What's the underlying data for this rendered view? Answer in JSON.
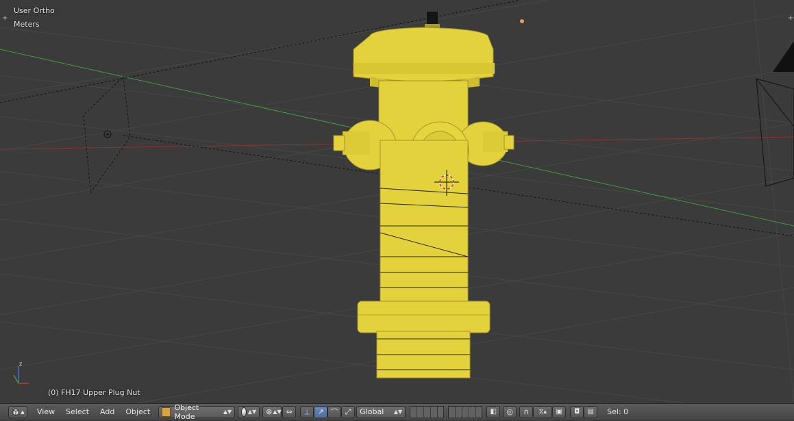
{
  "viewport": {
    "view_label": "User Ortho",
    "units_label": "Meters",
    "object_label": "(0) FH17 Upper Plug Nut"
  },
  "toolbar": {
    "menus": [
      "View",
      "Select",
      "Add",
      "Object"
    ],
    "mode": "Object Mode",
    "orientation": "Global",
    "selection": "Sel: 0"
  },
  "colors": {
    "viewport_bg": "#3b3b3b",
    "hydrant": "#e6d43a",
    "x_axis": "#a03a3a",
    "y_axis": "#3f9a3f"
  }
}
